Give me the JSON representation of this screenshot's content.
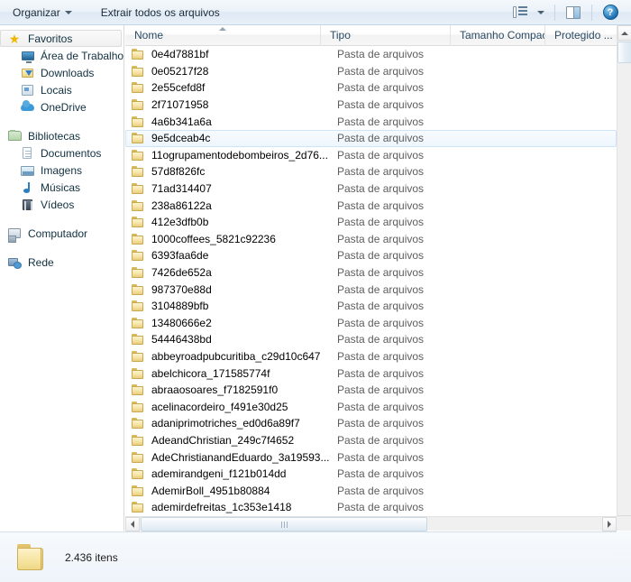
{
  "toolbar": {
    "organize_label": "Organizar",
    "extract_all_label": "Extrair todos os arquivos",
    "view_icon": "view-options-icon",
    "view_caret_icon": "chevron-down-icon",
    "preview_pane_icon": "preview-pane-icon",
    "help_label": "?"
  },
  "sidebar": {
    "groups": [
      {
        "header": {
          "label": "Favoritos",
          "icon": "star-icon",
          "selected": true
        },
        "items": [
          {
            "label": "Área de Trabalho",
            "icon": "desktop-icon"
          },
          {
            "label": "Downloads",
            "icon": "downloads-folder-icon"
          },
          {
            "label": "Locais",
            "icon": "recent-places-icon"
          },
          {
            "label": "OneDrive",
            "icon": "cloud-icon"
          }
        ]
      },
      {
        "header": {
          "label": "Bibliotecas",
          "icon": "libraries-icon",
          "selected": false
        },
        "items": [
          {
            "label": "Documentos",
            "icon": "document-icon"
          },
          {
            "label": "Imagens",
            "icon": "picture-icon"
          },
          {
            "label": "Músicas",
            "icon": "music-note-icon"
          },
          {
            "label": "Vídeos",
            "icon": "film-icon"
          }
        ]
      },
      {
        "header": {
          "label": "Computador",
          "icon": "computer-icon",
          "selected": false
        },
        "items": []
      },
      {
        "header": {
          "label": "Rede",
          "icon": "network-icon",
          "selected": false
        },
        "items": []
      }
    ]
  },
  "filelist": {
    "columns": [
      {
        "label": "Nome",
        "sorted": true,
        "sort_dir": "asc"
      },
      {
        "label": "Tipo",
        "sorted": false
      },
      {
        "label": "Tamanho Compact...",
        "sorted": false
      },
      {
        "label": "Protegido ...",
        "sorted": false
      }
    ],
    "rows": [
      {
        "name": "0e4d7881bf",
        "type": "Pasta de arquivos",
        "icon": "folder-icon"
      },
      {
        "name": "0e05217f28",
        "type": "Pasta de arquivos",
        "icon": "folder-icon"
      },
      {
        "name": "2e55cefd8f",
        "type": "Pasta de arquivos",
        "icon": "folder-icon"
      },
      {
        "name": "2f71071958",
        "type": "Pasta de arquivos",
        "icon": "folder-icon"
      },
      {
        "name": "4a6b341a6a",
        "type": "Pasta de arquivos",
        "icon": "folder-icon"
      },
      {
        "name": "9e5dceab4c",
        "type": "Pasta de arquivos",
        "icon": "folder-icon",
        "active": true
      },
      {
        "name": "11ogrupamentodebombeiros_2d76...",
        "type": "Pasta de arquivos",
        "icon": "folder-icon"
      },
      {
        "name": "57d8f826fc",
        "type": "Pasta de arquivos",
        "icon": "folder-icon"
      },
      {
        "name": "71ad314407",
        "type": "Pasta de arquivos",
        "icon": "folder-icon"
      },
      {
        "name": "238a86122a",
        "type": "Pasta de arquivos",
        "icon": "folder-icon"
      },
      {
        "name": "412e3dfb0b",
        "type": "Pasta de arquivos",
        "icon": "folder-icon"
      },
      {
        "name": "1000coffees_5821c92236",
        "type": "Pasta de arquivos",
        "icon": "folder-icon"
      },
      {
        "name": "6393faa6de",
        "type": "Pasta de arquivos",
        "icon": "folder-icon"
      },
      {
        "name": "7426de652a",
        "type": "Pasta de arquivos",
        "icon": "folder-icon"
      },
      {
        "name": "987370e88d",
        "type": "Pasta de arquivos",
        "icon": "folder-icon"
      },
      {
        "name": "3104889bfb",
        "type": "Pasta de arquivos",
        "icon": "folder-icon"
      },
      {
        "name": "13480666e2",
        "type": "Pasta de arquivos",
        "icon": "folder-icon"
      },
      {
        "name": "54446438bd",
        "type": "Pasta de arquivos",
        "icon": "folder-icon"
      },
      {
        "name": "abbeyroadpubcuritiba_c29d10c647",
        "type": "Pasta de arquivos",
        "icon": "folder-icon"
      },
      {
        "name": "abelchicora_171585774f",
        "type": "Pasta de arquivos",
        "icon": "folder-icon"
      },
      {
        "name": "abraaosoares_f7182591f0",
        "type": "Pasta de arquivos",
        "icon": "folder-icon"
      },
      {
        "name": "acelinacordeiro_f491e30d25",
        "type": "Pasta de arquivos",
        "icon": "folder-icon"
      },
      {
        "name": "adaniprimotriches_ed0d6a89f7",
        "type": "Pasta de arquivos",
        "icon": "folder-icon"
      },
      {
        "name": "AdeandChristian_249c7f4652",
        "type": "Pasta de arquivos",
        "icon": "folder-icon"
      },
      {
        "name": "AdeChristianandEduardo_3a19593...",
        "type": "Pasta de arquivos",
        "icon": "folder-icon"
      },
      {
        "name": "ademirandgeni_f121b014dd",
        "type": "Pasta de arquivos",
        "icon": "folder-icon"
      },
      {
        "name": "AdemirBoll_4951b80884",
        "type": "Pasta de arquivos",
        "icon": "folder-icon"
      },
      {
        "name": "ademirdefreitas_1c353e1418",
        "type": "Pasta de arquivos",
        "icon": "folder-icon"
      }
    ]
  },
  "statusbar": {
    "item_count_label": "2.436 itens",
    "icon": "folder-large-icon"
  },
  "colors": {
    "accent": "#3d9ad9",
    "folder": "#f0d78a",
    "selection": "#eef6fd",
    "text": "#000000",
    "muted_text": "#5d5d5d"
  }
}
